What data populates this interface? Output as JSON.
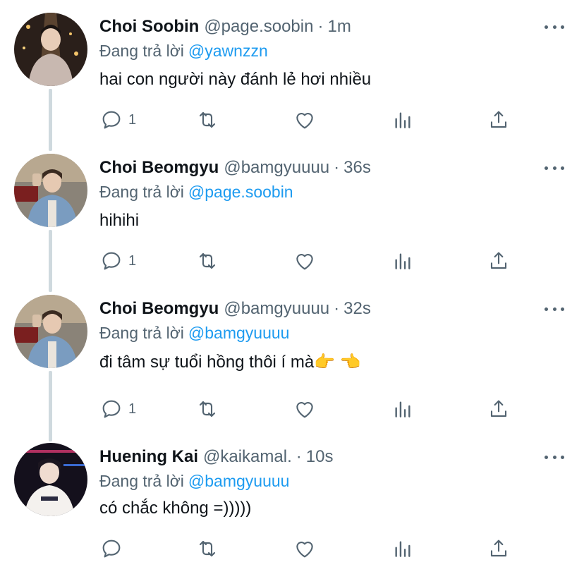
{
  "colors": {
    "text": "#0f1419",
    "muted": "#536471",
    "link": "#1d9bf0",
    "thread": "#cfd9de"
  },
  "reply_prefix": "Đang trả lời",
  "tweets": [
    {
      "name": "Choi Soobin",
      "handle": "@page.soobin",
      "dot": "·",
      "time": "1m",
      "reply_to": "@yawnzzn",
      "text": "hai con người này đánh lẻ hơi nhiều",
      "reply_count": "1",
      "icons": [
        "reply-icon",
        "retweet-icon",
        "like-icon",
        "analytics-icon",
        "share-icon"
      ]
    },
    {
      "name": "Choi Beomgyu",
      "handle": "@bamgyuuuu",
      "dot": "·",
      "time": "36s",
      "reply_to": "@page.soobin",
      "text": "hihihi",
      "reply_count": "1",
      "icons": [
        "reply-icon",
        "retweet-icon",
        "like-icon",
        "analytics-icon",
        "share-icon"
      ]
    },
    {
      "name": "Choi Beomgyu",
      "handle": "@bamgyuuuu",
      "dot": "·",
      "time": "32s",
      "reply_to": "@bamgyuuuu",
      "text": "đi tâm sự tuổi hồng thôi í mà👉 👈",
      "reply_count": "1",
      "icons": [
        "reply-icon",
        "retweet-icon",
        "like-icon",
        "analytics-icon",
        "share-icon"
      ]
    },
    {
      "name": "Huening Kai",
      "handle": "@kaikamal.",
      "dot": "·",
      "time": "10s",
      "reply_to": "@bamgyuuuu",
      "text": "có chắc không =)))))",
      "reply_count": "",
      "icons": [
        "reply-icon",
        "retweet-icon",
        "like-icon",
        "analytics-icon",
        "share-icon"
      ]
    }
  ]
}
